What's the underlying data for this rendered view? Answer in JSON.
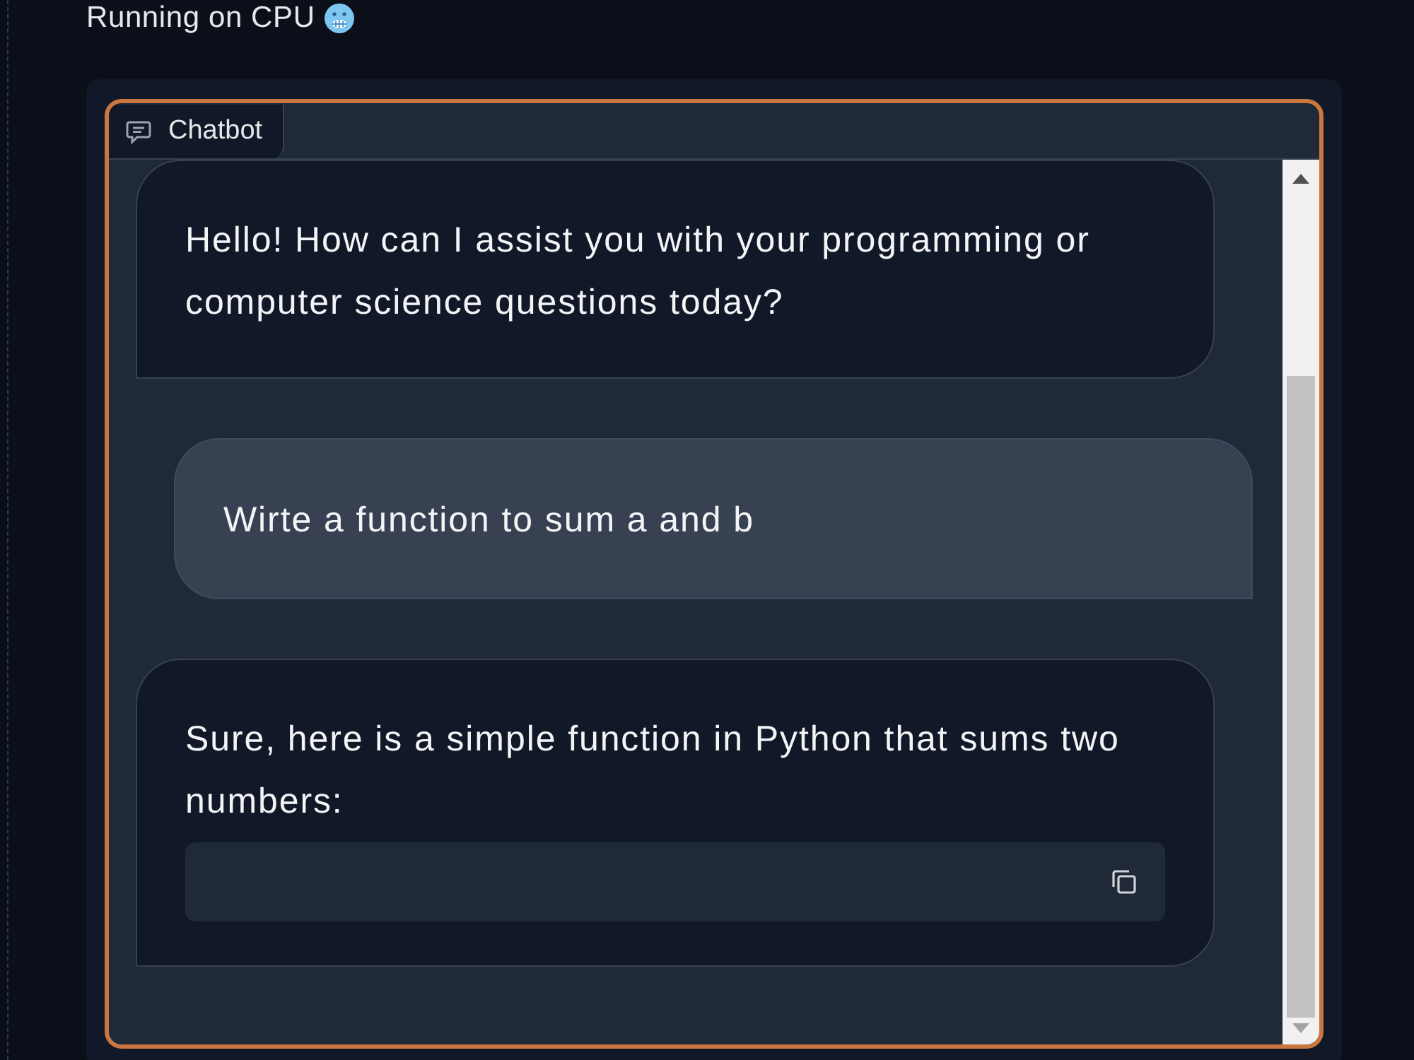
{
  "header": {
    "status": "Running on CPU"
  },
  "chatbot": {
    "label": "Chatbot",
    "messages": [
      {
        "kind": "bot",
        "text": "Hello! How can I assist you with your programming or computer science questions today?",
        "code_block": false
      },
      {
        "kind": "user",
        "text": "Wirte a function to sum a and b",
        "code_block": false
      },
      {
        "kind": "bot",
        "text": "Sure, here is a simple function in Python that sums two numbers:",
        "code_block": true
      }
    ]
  }
}
